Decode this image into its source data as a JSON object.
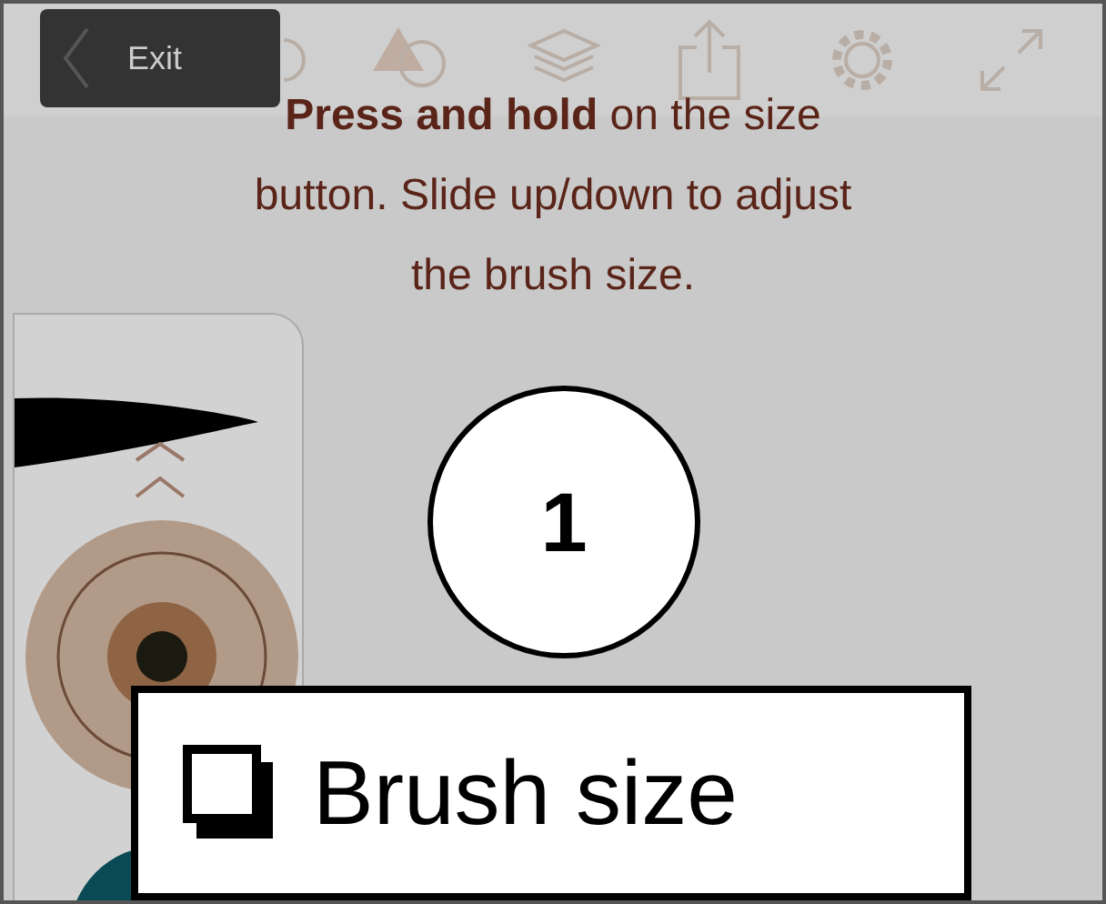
{
  "exit_button": {
    "label": "Exit"
  },
  "instruction": "**Press and hold** on the size button. Slide up/down to adjust the brush size.",
  "step_badge": "1",
  "callout": {
    "label": "Brush size"
  }
}
